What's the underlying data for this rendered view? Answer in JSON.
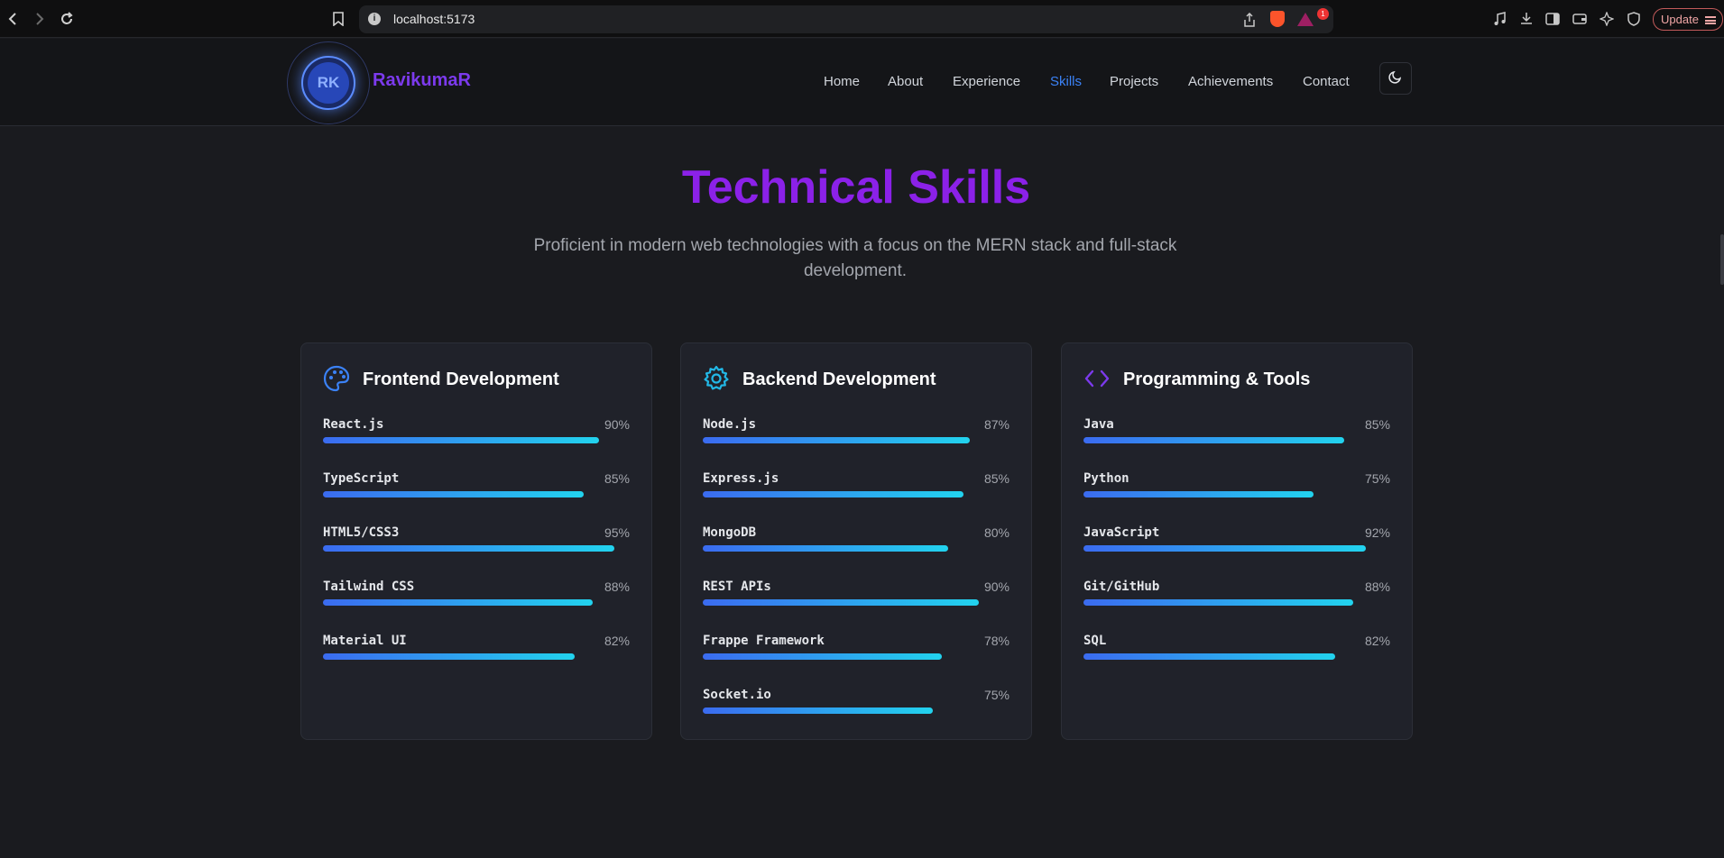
{
  "browser": {
    "url": "localhost:5173",
    "notification_count": "1",
    "update_label": "Update"
  },
  "header": {
    "logo_initials": "RK",
    "brand": "RavikumaR",
    "nav": [
      "Home",
      "About",
      "Experience",
      "Skills",
      "Projects",
      "Achievements",
      "Contact"
    ],
    "active_nav": "Skills"
  },
  "hero": {
    "title": "Technical Skills",
    "subtitle": "Proficient in modern web technologies with a focus on the MERN stack and full-stack development."
  },
  "cards": [
    {
      "title": "Frontend Development",
      "icon": "palette-icon",
      "skills": [
        {
          "name": "React.js",
          "percent": "90%",
          "value": 90
        },
        {
          "name": "TypeScript",
          "percent": "85%",
          "value": 85
        },
        {
          "name": "HTML5/CSS3",
          "percent": "95%",
          "value": 95
        },
        {
          "name": "Tailwind CSS",
          "percent": "88%",
          "value": 88
        },
        {
          "name": "Material UI",
          "percent": "82%",
          "value": 82
        }
      ]
    },
    {
      "title": "Backend Development",
      "icon": "gear-icon",
      "skills": [
        {
          "name": "Node.js",
          "percent": "87%",
          "value": 87
        },
        {
          "name": "Express.js",
          "percent": "85%",
          "value": 85
        },
        {
          "name": "MongoDB",
          "percent": "80%",
          "value": 80
        },
        {
          "name": "REST APIs",
          "percent": "90%",
          "value": 90
        },
        {
          "name": "Frappe Framework",
          "percent": "78%",
          "value": 78
        },
        {
          "name": "Socket.io",
          "percent": "75%",
          "value": 75
        }
      ]
    },
    {
      "title": "Programming & Tools",
      "icon": "code-icon",
      "skills": [
        {
          "name": "Java",
          "percent": "85%",
          "value": 85
        },
        {
          "name": "Python",
          "percent": "75%",
          "value": 75
        },
        {
          "name": "JavaScript",
          "percent": "92%",
          "value": 92
        },
        {
          "name": "Git/GitHub",
          "percent": "88%",
          "value": 88
        },
        {
          "name": "SQL",
          "percent": "82%",
          "value": 82
        }
      ]
    }
  ],
  "colors": {
    "accent_purple": "#8b21e8",
    "active_nav": "#3b82f6",
    "bar_start": "#3b6bf0",
    "bar_end": "#22d3ee"
  }
}
